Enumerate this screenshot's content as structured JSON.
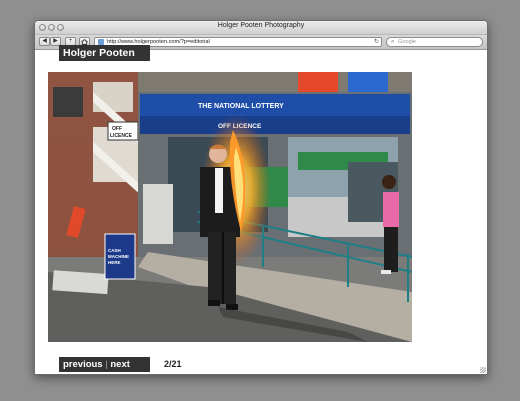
{
  "window": {
    "title": "Holger Pooten Photography"
  },
  "toolbar": {
    "back_icon": "back-arrow-icon",
    "forward_icon": "forward-arrow-icon",
    "add_icon": "plus-icon",
    "home_icon": "home-icon",
    "url": "http://www.holgerpooten.com/?p=editorial",
    "reload_icon": "reload-icon",
    "search_placeholder": "Google"
  },
  "site": {
    "logo_text": "Holger Pooten",
    "photo": {
      "description_icon": "photo-burning-man-icon",
      "signs": {
        "off_licence": "OFF LICENCE",
        "national_lottery": "THE NATIONAL LOTTERY",
        "cash_machine": "CASH MACHINE HERE"
      }
    },
    "nav": {
      "previous": "previous",
      "separator": "|",
      "next": "next"
    },
    "counter": "2/21"
  },
  "colors": {
    "logo_bg": "#333333",
    "page_bg": "#8f8f8f",
    "shop_blue": "#1f4ea8",
    "shop_green": "#2f8a4a",
    "fire": "#ff8a1c"
  }
}
